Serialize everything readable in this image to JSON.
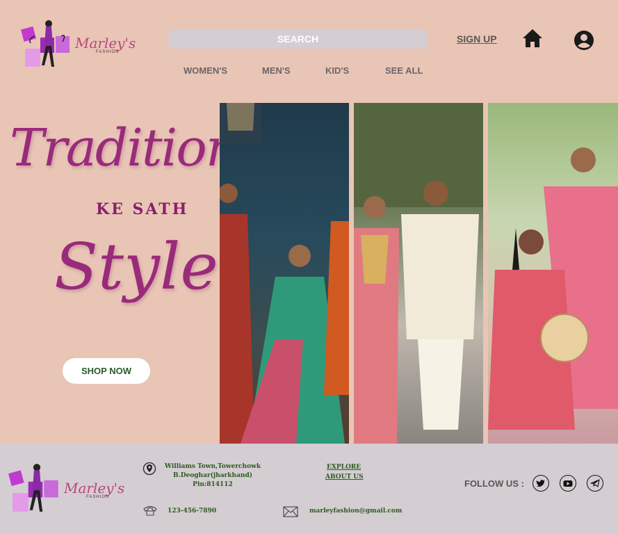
{
  "header": {
    "brand": "Marley's",
    "brand_sub": "FASHION",
    "search_label": "SEARCH",
    "signup_label": "SIGN UP",
    "nav": [
      "WOMEN'S",
      "MEN'S",
      "KID'S",
      "SEE ALL"
    ]
  },
  "hero": {
    "line1": "Tradition",
    "line2": "KE SATH",
    "line3": "Style",
    "cta_label": "SHOP NOW"
  },
  "footer": {
    "brand": "Marley's",
    "brand_sub": "FASHION",
    "address": [
      "Williams Town,Towerchowk",
      "B.Deoghar(jharkhand)",
      "Pin:814112"
    ],
    "links": [
      "EXPLORE",
      "ABOUT US"
    ],
    "phone": "123-456-7890",
    "email": "marleyfashion@gmail.com",
    "follow_label": "FOLLOW US :"
  },
  "colors": {
    "background": "#e9c5b6",
    "accent_purple": "#9a2a7a",
    "footer_bg": "#d4cdd2",
    "footer_text": "#2d5a1f"
  },
  "icons": [
    "home-icon",
    "account-icon",
    "location-pin-icon",
    "phone-icon",
    "mail-icon",
    "twitter-icon",
    "youtube-icon",
    "telegram-icon"
  ]
}
